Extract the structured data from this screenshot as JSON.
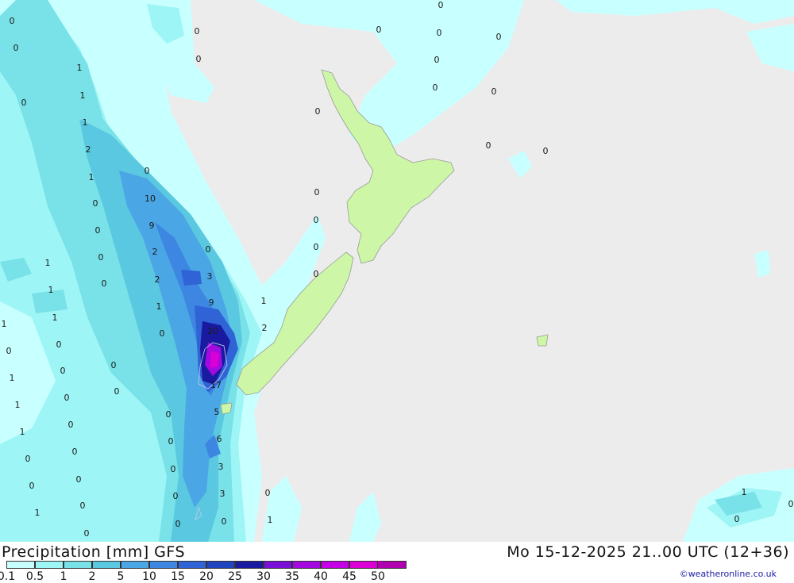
{
  "header": {
    "title": "Precipitation [mm] GFS",
    "timestamp": "Mo 15-12-2025 21..00 UTC (12+36)",
    "credit": "©weatheronline.co.uk"
  },
  "legend": {
    "ticks": [
      "0.1",
      "0.5",
      "1",
      "2",
      "5",
      "10",
      "15",
      "20",
      "25",
      "30",
      "35",
      "40",
      "45",
      "50"
    ],
    "colors": [
      "#c8ffff",
      "#9ef5f5",
      "#78e2e8",
      "#5ac8e0",
      "#4aa6e4",
      "#3d86e2",
      "#2f63d6",
      "#2043be",
      "#1a1aa0",
      "#7a10d8",
      "#a40ae0",
      "#c400e6",
      "#dc00d6",
      "#b000b0"
    ]
  },
  "map_colors": {
    "sea": "#ececec",
    "land": "#cdf7a6",
    "coast": "#9a9a9a"
  },
  "map_labels": [
    {
      "v": "0"
    },
    {
      "v": "0"
    },
    {
      "v": "0"
    },
    {
      "v": "0"
    },
    {
      "v": "0"
    },
    {
      "v": "0"
    },
    {
      "v": "0"
    },
    {
      "v": "0"
    },
    {
      "v": "0"
    },
    {
      "v": "0"
    },
    {
      "v": "0"
    },
    {
      "v": "0"
    },
    {
      "v": "0"
    },
    {
      "v": "0"
    },
    {
      "v": "0"
    },
    {
      "v": "0"
    },
    {
      "v": "1"
    },
    {
      "v": "1"
    },
    {
      "v": "1"
    },
    {
      "v": "2"
    },
    {
      "v": "1"
    },
    {
      "v": "0"
    },
    {
      "v": "10"
    },
    {
      "v": "0"
    },
    {
      "v": "9"
    },
    {
      "v": "0"
    },
    {
      "v": "2"
    },
    {
      "v": "0"
    },
    {
      "v": "2"
    },
    {
      "v": "3"
    },
    {
      "v": "0"
    },
    {
      "v": "1"
    },
    {
      "v": "9"
    },
    {
      "v": "1"
    },
    {
      "v": "0"
    },
    {
      "v": "20"
    },
    {
      "v": "2"
    },
    {
      "v": "17"
    },
    {
      "v": "5"
    },
    {
      "v": "6"
    },
    {
      "v": "3"
    },
    {
      "v": "3"
    },
    {
      "v": "0"
    },
    {
      "v": "1"
    },
    {
      "v": "1"
    },
    {
      "v": "1"
    },
    {
      "v": "0"
    },
    {
      "v": "0"
    },
    {
      "v": "1"
    },
    {
      "v": "1"
    },
    {
      "v": "1"
    },
    {
      "v": "0"
    },
    {
      "v": "0"
    },
    {
      "v": "0"
    },
    {
      "v": "0"
    },
    {
      "v": "0"
    },
    {
      "v": "0"
    },
    {
      "v": "0"
    },
    {
      "v": "0"
    },
    {
      "v": "0"
    },
    {
      "v": "0"
    },
    {
      "v": "0"
    },
    {
      "v": "0"
    },
    {
      "v": "0"
    },
    {
      "v": "1"
    },
    {
      "v": "0"
    },
    {
      "v": "1"
    },
    {
      "v": "0"
    },
    {
      "v": "0"
    },
    {
      "v": "0"
    },
    {
      "v": "0"
    },
    {
      "v": "0"
    },
    {
      "v": "0"
    },
    {
      "v": "0"
    },
    {
      "v": "1"
    },
    {
      "v": "1"
    },
    {
      "v": "0"
    },
    {
      "v": "0"
    }
  ]
}
